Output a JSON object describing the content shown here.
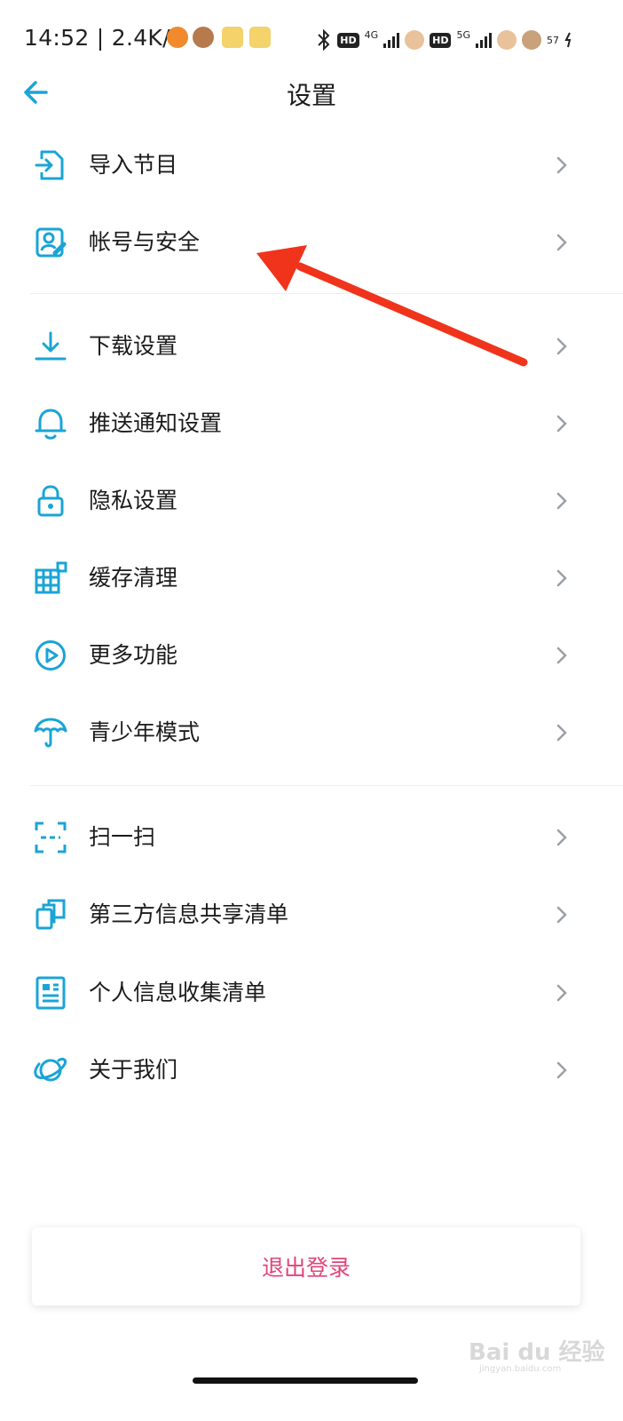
{
  "status_bar": {
    "time_network": "14:52 | 2.4K/s",
    "net_a": "4G",
    "net_b": "5G",
    "hd": "HD",
    "battery": "57"
  },
  "header": {
    "title": "设置"
  },
  "menu": {
    "import": "导入节目",
    "account": "帐号与安全",
    "download": "下载设置",
    "push": "推送通知设置",
    "privacy": "隐私设置",
    "cache": "缓存清理",
    "more": "更多功能",
    "teen": "青少年模式",
    "scan": "扫一扫",
    "third_party": "第三方信息共享清单",
    "personal_info": "个人信息收集清单",
    "about": "关于我们"
  },
  "logout": {
    "label": "退出登录"
  },
  "watermark": {
    "text": "Bai du 经验",
    "sub": "jingyan.baidu.com"
  },
  "colors": {
    "icon_accent": "#1aa4d6",
    "logout_text": "#e0457b",
    "annotation_arrow": "#f0341c"
  }
}
